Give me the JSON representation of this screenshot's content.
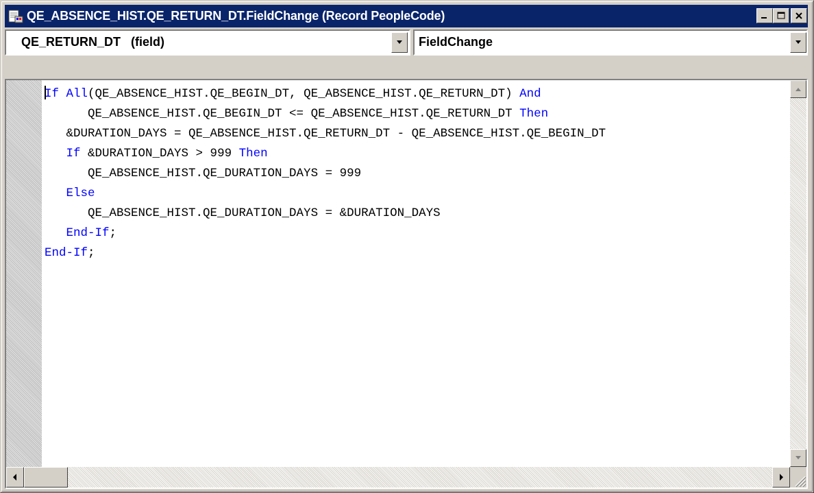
{
  "window": {
    "title": "QE_ABSENCE_HIST.QE_RETURN_DT.FieldChange (Record PeopleCode)",
    "icon": "peoplecode-window-icon"
  },
  "toolbar": {
    "field_combo": "QE_RETURN_DT   (field)",
    "event_combo": "FieldChange"
  },
  "editor": {
    "lines": [
      "If All(QE_ABSENCE_HIST.QE_BEGIN_DT, QE_ABSENCE_HIST.QE_RETURN_DT) And",
      "      QE_ABSENCE_HIST.QE_BEGIN_DT <= QE_ABSENCE_HIST.QE_RETURN_DT Then",
      "   &DURATION_DAYS = QE_ABSENCE_HIST.QE_RETURN_DT - QE_ABSENCE_HIST.QE_BEGIN_DT",
      "   If &DURATION_DAYS > 999 Then",
      "      QE_ABSENCE_HIST.QE_DURATION_DAYS = 999",
      "   Else",
      "      QE_ABSENCE_HIST.QE_DURATION_DAYS = &DURATION_DAYS",
      "   End-If;",
      "End-If;"
    ],
    "keywords": [
      "If",
      "All",
      "And",
      "Then",
      "Else",
      "End-If"
    ]
  },
  "colors": {
    "titlebar": "#0a246a",
    "keyword": "#0000ff",
    "chrome": "#d4d0c8"
  }
}
